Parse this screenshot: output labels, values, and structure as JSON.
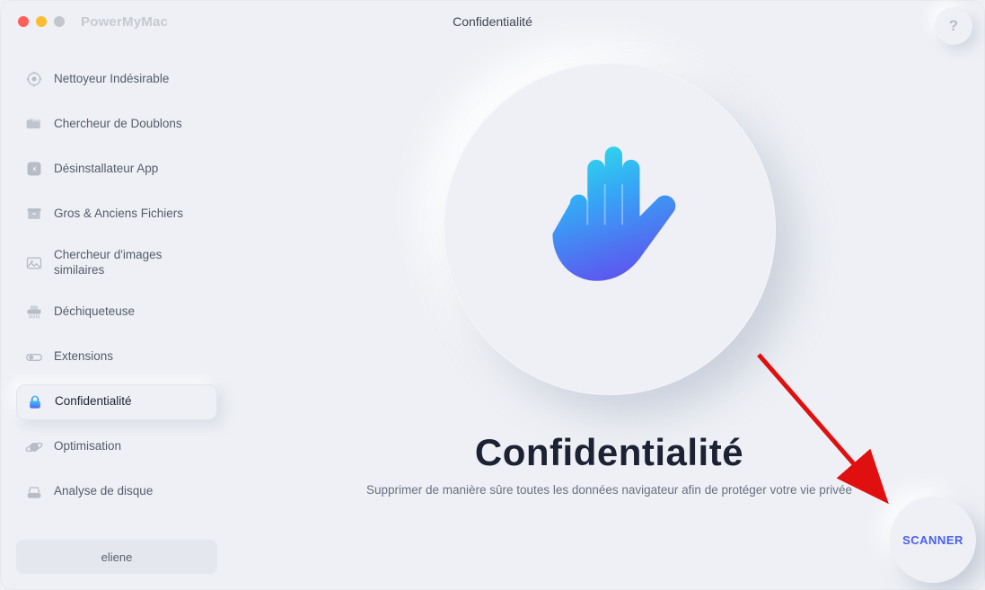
{
  "app_name": "PowerMyMac",
  "header": {
    "title": "Confidentialité"
  },
  "help_label": "?",
  "sidebar": {
    "items": [
      {
        "label": "Nettoyeur Indésirable",
        "active": false
      },
      {
        "label": "Chercheur de Doublons",
        "active": false
      },
      {
        "label": "Désinstallateur App",
        "active": false
      },
      {
        "label": "Gros & Anciens Fichiers",
        "active": false
      },
      {
        "label": "Chercheur d'images similaires",
        "active": false
      },
      {
        "label": "Déchiqueteuse",
        "active": false
      },
      {
        "label": "Extensions",
        "active": false
      },
      {
        "label": "Confidentialité",
        "active": true
      },
      {
        "label": "Optimisation",
        "active": false
      },
      {
        "label": "Analyse de disque",
        "active": false
      }
    ]
  },
  "user": {
    "name": "eliene"
  },
  "main": {
    "title": "Confidentialité",
    "subtitle": "Supprimer de manière sûre toutes les données navigateur afin de protéger votre vie privée",
    "scan_label": "SCANNER"
  },
  "colors": {
    "accent": "#4a5ff0",
    "icon_gray": "#b7bcc7",
    "hand_grad_top": "#2fe3ea",
    "hand_grad_bottom": "#5a5cf0",
    "annotation_red": "#e11010"
  }
}
